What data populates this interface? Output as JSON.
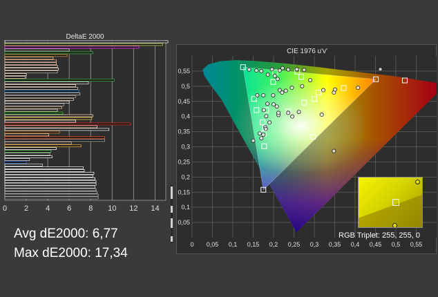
{
  "bar_panel": {
    "title": "DeltaE 2000"
  },
  "stats": {
    "avg": "Avg dE2000: 6,77",
    "max": "Max dE2000: 17,34"
  },
  "cie_panel": {
    "title": "CIE 1976 u'v'",
    "rgb_triplet": "RGB Triplet: 255, 255, 0"
  },
  "chart_data": [
    {
      "type": "bar",
      "orientation": "horizontal",
      "title": "DeltaE 2000",
      "xlim": [
        0,
        15
      ],
      "xticks": [
        0,
        2,
        4,
        6,
        8,
        10,
        12,
        14
      ],
      "grid": true,
      "values": [
        15.2,
        14.7,
        12.5,
        6.0,
        8.2,
        5.8,
        4.5,
        4.8,
        4.8,
        4.9,
        5.0,
        4.9,
        2.0,
        1.9,
        10.2,
        7.8,
        6.6,
        6.8,
        6.9,
        7.0,
        6.6,
        6.4,
        6.0,
        5.5,
        5.3,
        4.9,
        5.4,
        8.2,
        8.1,
        6.6,
        11.7,
        8.6,
        9.7,
        5.1,
        4.1,
        9.3,
        9.3,
        6.2,
        7.1,
        4.8,
        4.3,
        4.2,
        4.4,
        2.3,
        2.0,
        3.5,
        7.3,
        7.4,
        8.3,
        8.2,
        8.4,
        8.5,
        8.5,
        8.4,
        8.5,
        8.6,
        8.7,
        8.7
      ],
      "colors": [
        "#f8f8f8",
        "#c8c850",
        "#e040e0",
        "#c0c0c0",
        "#3aa83a",
        "#d09040",
        "#e8c0a0",
        "#e8b890",
        "#f0c8b0",
        "#f4d4bc",
        "#f0e0d0",
        "#c8b8a8",
        "#f0d8c0",
        "#e8c8b0",
        "#40a040",
        "#e8e0d8",
        "#f0d0c0",
        "#c8c0a8",
        "#3080c0",
        "#d0c0c0",
        "#a0a0a0",
        "#e8d0b0",
        "#f8f0e8",
        "#a8a8a8",
        "#e0c0a0",
        "#f0d8c0",
        "#30c030",
        "#f8e0c0",
        "#e8c848",
        "#f8f8f8",
        "#d83020",
        "#f8c0b0",
        "#e8e8e8",
        "#d08030",
        "#f0d0a0",
        "#e85020",
        "#a0a0a0",
        "#d0b0a0",
        "#e8b040",
        "#f8f8f8",
        "#60c060",
        "#c0c0c0",
        "#f0f0f0",
        "#d0d0d0",
        "#3060c0",
        "#e0e0e0",
        "#f0f0f0",
        "#ffffff",
        "#f4f4f4",
        "#e8e8e8",
        "#ffffff",
        "#f0f0f0",
        "#e4e4e4",
        "#d8d8d8",
        "#cccccc",
        "#c0c0c0",
        "#b4b4b4",
        "#a8a8a8"
      ]
    },
    {
      "type": "scatter",
      "title": "CIE 1976 u'v'",
      "xlim": [
        0,
        0.6
      ],
      "ylim": [
        0,
        0.6
      ],
      "xticks": [
        0,
        0.05,
        0.1,
        0.15,
        0.2,
        0.25,
        0.3,
        0.35,
        0.4,
        0.45,
        0.5,
        0.55
      ],
      "yticks": [
        0.05,
        0.1,
        0.15,
        0.2,
        0.25,
        0.3,
        0.35,
        0.4,
        0.45,
        0.5,
        0.55
      ],
      "xticklabels": [
        "0",
        "0,05",
        "0,1",
        "0,15",
        "0,2",
        "0,25",
        "0,3",
        "0,35",
        "0,4",
        "0,45",
        "0,5",
        "0,55"
      ],
      "yticklabels": [
        "0,05",
        "0,1",
        "0,15",
        "0,2",
        "0,25",
        "0,3",
        "0,35",
        "0,4",
        "0,45",
        "0,5",
        "0,55"
      ],
      "grid": true,
      "gamut_triangle": [
        [
          0.451,
          0.523
        ],
        [
          0.125,
          0.563
        ],
        [
          0.175,
          0.158
        ]
      ],
      "targets": [
        [
          0.125,
          0.563
        ],
        [
          0.175,
          0.158
        ],
        [
          0.451,
          0.523
        ],
        [
          0.204,
          0.546
        ],
        [
          0.258,
          0.548
        ],
        [
          0.182,
          0.421
        ],
        [
          0.177,
          0.302
        ],
        [
          0.152,
          0.458
        ],
        [
          0.199,
          0.514
        ],
        [
          0.158,
          0.421
        ],
        [
          0.173,
          0.381
        ],
        [
          0.179,
          0.363
        ],
        [
          0.176,
          0.344
        ],
        [
          0.236,
          0.417
        ],
        [
          0.275,
          0.446
        ],
        [
          0.3,
          0.458
        ],
        [
          0.31,
          0.479
        ],
        [
          0.372,
          0.494
        ],
        [
          0.522,
          0.519
        ],
        [
          0.268,
          0.531
        ],
        [
          0.297,
          0.333
        ]
      ],
      "measurements": [
        [
          0.14,
          0.555
        ],
        [
          0.158,
          0.552
        ],
        [
          0.17,
          0.55
        ],
        [
          0.196,
          0.556
        ],
        [
          0.215,
          0.552
        ],
        [
          0.222,
          0.56
        ],
        [
          0.236,
          0.555
        ],
        [
          0.257,
          0.556
        ],
        [
          0.275,
          0.554
        ],
        [
          0.186,
          0.538
        ],
        [
          0.203,
          0.534
        ],
        [
          0.21,
          0.524
        ],
        [
          0.16,
          0.47
        ],
        [
          0.175,
          0.47
        ],
        [
          0.199,
          0.47
        ],
        [
          0.215,
          0.487
        ],
        [
          0.221,
          0.479
        ],
        [
          0.23,
          0.485
        ],
        [
          0.245,
          0.495
        ],
        [
          0.27,
          0.5
        ],
        [
          0.29,
          0.52
        ],
        [
          0.322,
          0.487
        ],
        [
          0.348,
          0.479
        ],
        [
          0.407,
          0.495
        ],
        [
          0.185,
          0.442
        ],
        [
          0.2,
          0.44
        ],
        [
          0.208,
          0.433
        ],
        [
          0.176,
          0.421
        ],
        [
          0.182,
          0.401
        ],
        [
          0.19,
          0.38
        ],
        [
          0.212,
          0.405
        ],
        [
          0.236,
          0.412
        ],
        [
          0.246,
          0.4
        ],
        [
          0.262,
          0.415
        ],
        [
          0.318,
          0.406
        ],
        [
          0.18,
          0.365
        ],
        [
          0.175,
          0.34
        ],
        [
          0.181,
          0.359
        ],
        [
          0.166,
          0.344
        ],
        [
          0.17,
          0.328
        ],
        [
          0.15,
          0.32
        ],
        [
          0.351,
          0.489
        ],
        [
          0.462,
          0.556
        ],
        [
          0.348,
          0.286
        ],
        [
          0.212,
          0.412
        ]
      ],
      "inset_label": "RGB Triplet: 255, 255, 0"
    }
  ]
}
